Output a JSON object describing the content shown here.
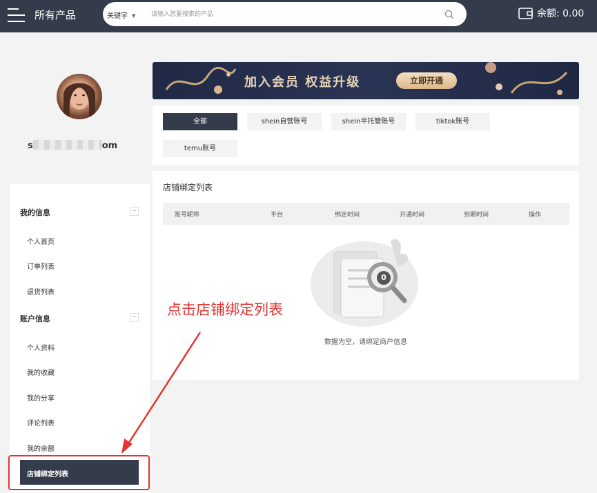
{
  "header": {
    "title": "所有产品",
    "search": {
      "type_label": "关键字",
      "placeholder": "请输入您要搜索的产品",
      "value": ""
    },
    "balance": "余额: 0.00"
  },
  "profile": {
    "username_start": "s",
    "username_end": "om"
  },
  "sidebar": {
    "groups": [
      {
        "title": "我的信息",
        "collapse": "−",
        "items": [
          "个人首页",
          "订单列表",
          "退货列表"
        ]
      },
      {
        "title": "账户信息",
        "collapse": "−",
        "items": [
          "个人资料",
          "我的收藏",
          "我的分享",
          "评论列表",
          "我的余额",
          "店铺绑定列表"
        ]
      }
    ],
    "active_item": "店铺绑定列表"
  },
  "banner": {
    "title": "加入会员 权益升级",
    "button": "立即开通"
  },
  "filters": [
    "全部",
    "shein自营账号",
    "shein半托管账号",
    "tiktok账号",
    "temu账号"
  ],
  "panel": {
    "title": "店铺绑定列表",
    "columns": [
      "账号昵称",
      "平台",
      "绑定时间",
      "开通时间",
      "到期时间",
      "操作"
    ],
    "empty_text": "数据为空，请绑定商户信息",
    "empty_count": "0"
  },
  "annotation": {
    "text": "点击店铺绑定列表"
  },
  "colors": {
    "header_bg": "#343b4a",
    "annotation_red": "#e3342f",
    "banner_gold": "#e7d4b6"
  }
}
